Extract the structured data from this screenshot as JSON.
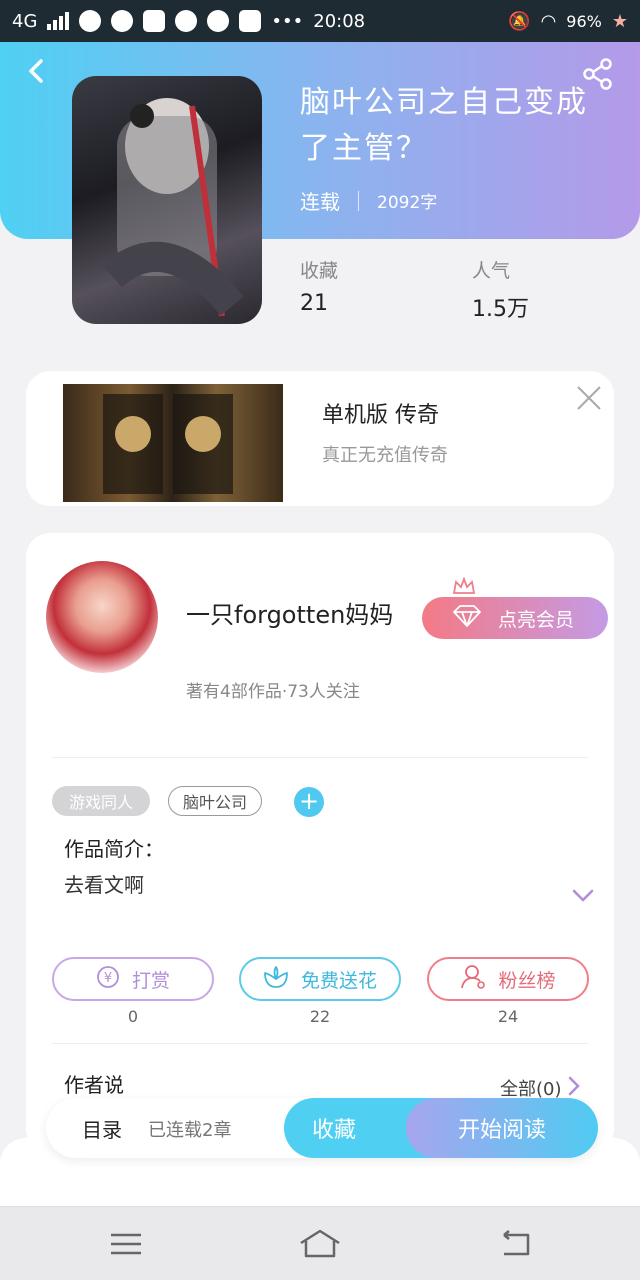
{
  "status_bar": {
    "network": "4G",
    "time": "20:08",
    "battery": "96%"
  },
  "book": {
    "title": "脑叶公司之自己变成了主管？",
    "status": "连载",
    "word_count": "2092字",
    "stats": [
      {
        "label": "收藏",
        "value": "21"
      },
      {
        "label": "人气",
        "value": "1.5万"
      }
    ]
  },
  "ad": {
    "title": "单机版 传奇",
    "subtitle": "真正无充值传奇"
  },
  "author": {
    "name": "一只forgotten妈妈",
    "meta": "著有4部作品·73人关注",
    "vip_label": "点亮会员"
  },
  "tags": [
    "游戏同人",
    "脑叶公司"
  ],
  "intro": {
    "heading": "作品简介：",
    "text": "去看文啊"
  },
  "actions": [
    {
      "label": "打赏",
      "count": "0",
      "icon": "yen-icon"
    },
    {
      "label": "免费送花",
      "count": "22",
      "icon": "flower-icon"
    },
    {
      "label": "粉丝榜",
      "count": "24",
      "icon": "user-icon"
    }
  ],
  "author_says": {
    "heading": "作者说",
    "all_label": "全部(0)"
  },
  "bottom_bar": {
    "toc": "目录",
    "chapters": "已连载2章",
    "favorite": "收藏",
    "read": "开始阅读"
  },
  "colors": {
    "header_gradient_start": "#4fd0f3",
    "header_gradient_end": "#b49ae9",
    "accent_cyan": "#4fd0f3",
    "vip_pink": "#f47a85"
  }
}
